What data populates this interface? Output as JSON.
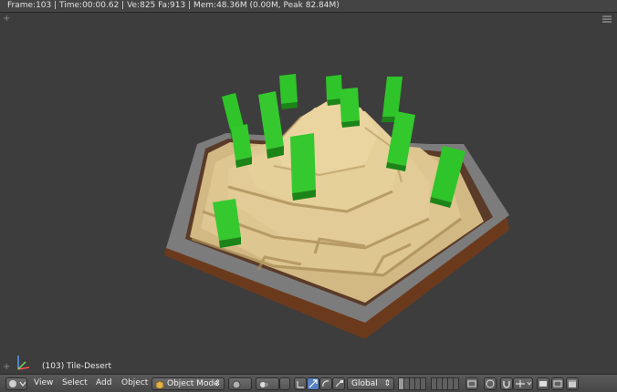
{
  "stats": {
    "text": "Frame:103 | Time:00:00.62 | Ve:825 Fa:913 | Mem:48.36M (0.00M, Peak 82.84M)"
  },
  "viewport": {
    "object_label": "(103) Tile-Desert",
    "colors": {
      "background": "#3d3d3d",
      "sand": "#d8bf88",
      "cactus": "#2fc42a",
      "rim": "#7a7a7a",
      "soil": "#6b3a1d"
    }
  },
  "header": {
    "menus": [
      "View",
      "Select",
      "Add",
      "Object"
    ],
    "mode_label": "Object Mode",
    "orientation_label": "Global"
  }
}
